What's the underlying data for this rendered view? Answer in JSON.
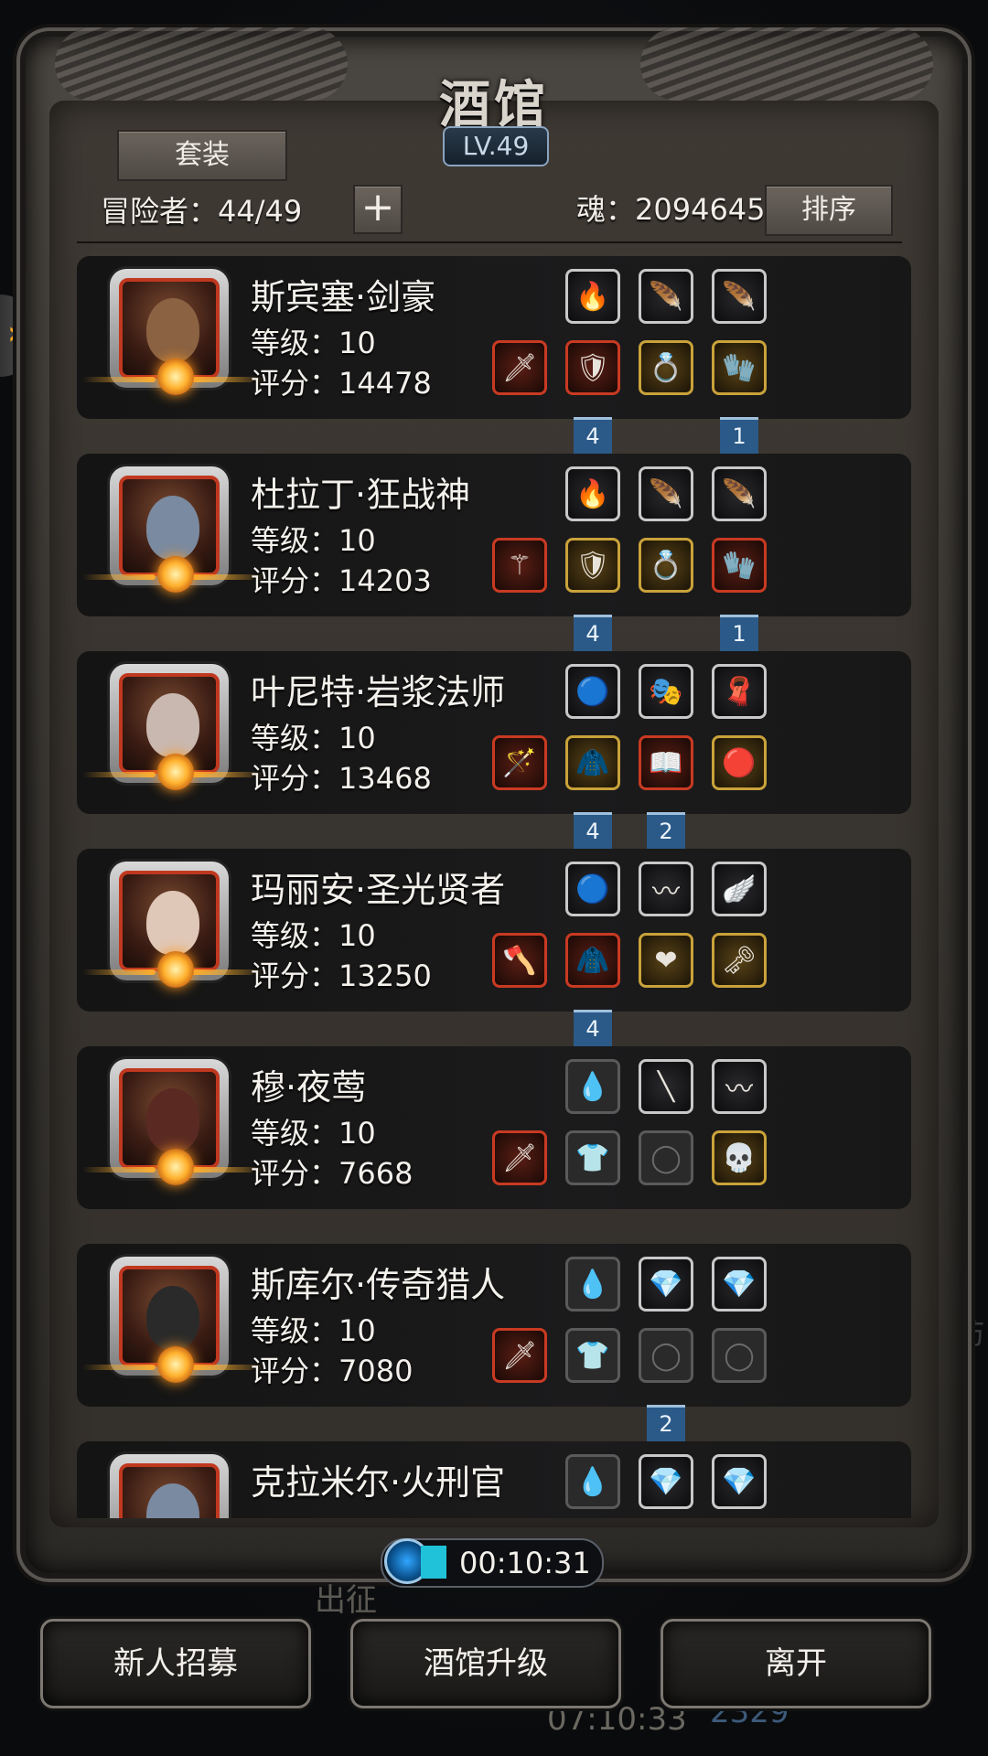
{
  "title": "酒馆",
  "level": "LV.49",
  "set_button": "套装",
  "adventurers": "冒险者：44/49",
  "add_button": "+",
  "soul": "魂：2094645",
  "sort_button": "排序",
  "heroes": [
    {
      "name": "斯宾塞·剑豪",
      "level": "等级：10",
      "score": "评分：14478",
      "top_slots": [
        {
          "style": "silver",
          "icon": "🔥"
        },
        {
          "style": "silver",
          "icon": "🪶"
        },
        {
          "style": "silver",
          "icon": "🪶"
        }
      ],
      "bottom_slots": [
        {
          "style": "red",
          "icon": "🗡"
        },
        {
          "style": "red",
          "icon": "🛡"
        },
        {
          "style": "gold",
          "icon": "💍"
        },
        {
          "style": "gold",
          "icon": "🧤"
        }
      ],
      "ribbons": [
        {
          "slot": 1,
          "text": "4"
        },
        {
          "slot": 3,
          "text": "1"
        }
      ]
    },
    {
      "name": "杜拉丁·狂战神",
      "level": "等级：10",
      "score": "评分：14203",
      "top_slots": [
        {
          "style": "silver",
          "icon": "🔥"
        },
        {
          "style": "silver",
          "icon": "🪶"
        },
        {
          "style": "silver",
          "icon": "🪶"
        }
      ],
      "bottom_slots": [
        {
          "style": "red",
          "icon": "⚚"
        },
        {
          "style": "gold",
          "icon": "🛡"
        },
        {
          "style": "gold",
          "icon": "💍"
        },
        {
          "style": "red",
          "icon": "🧤"
        }
      ],
      "ribbons": [
        {
          "slot": 1,
          "text": "4"
        },
        {
          "slot": 3,
          "text": "1"
        }
      ]
    },
    {
      "name": "叶尼特·岩浆法师",
      "level": "等级：10",
      "score": "评分：13468",
      "top_slots": [
        {
          "style": "silver",
          "icon": "🔵"
        },
        {
          "style": "silver",
          "icon": "🎭"
        },
        {
          "style": "silver",
          "icon": "🧣"
        }
      ],
      "bottom_slots": [
        {
          "style": "red",
          "icon": "🪄"
        },
        {
          "style": "gold",
          "icon": "🧥"
        },
        {
          "style": "red",
          "icon": "📖"
        },
        {
          "style": "gold",
          "icon": "🔴"
        }
      ],
      "ribbons": [
        {
          "slot": 1,
          "text": "4"
        },
        {
          "slot": 2,
          "text": "2"
        }
      ]
    },
    {
      "name": "玛丽安·圣光贤者",
      "level": "等级：10",
      "score": "评分：13250",
      "top_slots": [
        {
          "style": "silver",
          "icon": "🔵"
        },
        {
          "style": "silver",
          "icon": "〰"
        },
        {
          "style": "silver",
          "icon": "🪽"
        }
      ],
      "bottom_slots": [
        {
          "style": "red",
          "icon": "🪓"
        },
        {
          "style": "red",
          "icon": "🧥"
        },
        {
          "style": "gold",
          "icon": "❤"
        },
        {
          "style": "gold",
          "icon": "🗝"
        }
      ],
      "ribbons": [
        {
          "slot": 1,
          "text": "4"
        }
      ]
    },
    {
      "name": "穆·夜莺",
      "level": "等级：10",
      "score": "评分：7668",
      "top_slots": [
        {
          "style": "empty",
          "icon": "💧"
        },
        {
          "style": "silver",
          "icon": "╲"
        },
        {
          "style": "silver",
          "icon": "〰"
        }
      ],
      "bottom_slots": [
        {
          "style": "red",
          "icon": "🗡"
        },
        {
          "style": "empty",
          "icon": "👕"
        },
        {
          "style": "empty",
          "icon": "◯"
        },
        {
          "style": "gold",
          "icon": "💀"
        }
      ],
      "ribbons": []
    },
    {
      "name": "斯库尔·传奇猎人",
      "level": "等级：10",
      "score": "评分：7080",
      "top_slots": [
        {
          "style": "empty",
          "icon": "💧"
        },
        {
          "style": "silver",
          "icon": "💎"
        },
        {
          "style": "silver",
          "icon": "💎"
        }
      ],
      "bottom_slots": [
        {
          "style": "red",
          "icon": "🗡"
        },
        {
          "style": "empty",
          "icon": "👕"
        },
        {
          "style": "empty",
          "icon": "◯"
        },
        {
          "style": "empty",
          "icon": "◯"
        }
      ],
      "ribbons": [
        {
          "slot": 2,
          "text": "2"
        }
      ]
    },
    {
      "name": "克拉米尔·火刑官",
      "level": "",
      "score": "",
      "top_slots": [
        {
          "style": "empty",
          "icon": "💧"
        },
        {
          "style": "silver",
          "icon": "💎"
        },
        {
          "style": "silver",
          "icon": "💎"
        }
      ],
      "bottom_slots": [],
      "ribbons": []
    }
  ],
  "timer": "00:10:31",
  "under_expedition": "出征",
  "under_time": "07:10:33",
  "under_number": "2329",
  "bottom_buttons": [
    "新人招募",
    "酒馆升级",
    "离开"
  ],
  "bg_word": "坊"
}
